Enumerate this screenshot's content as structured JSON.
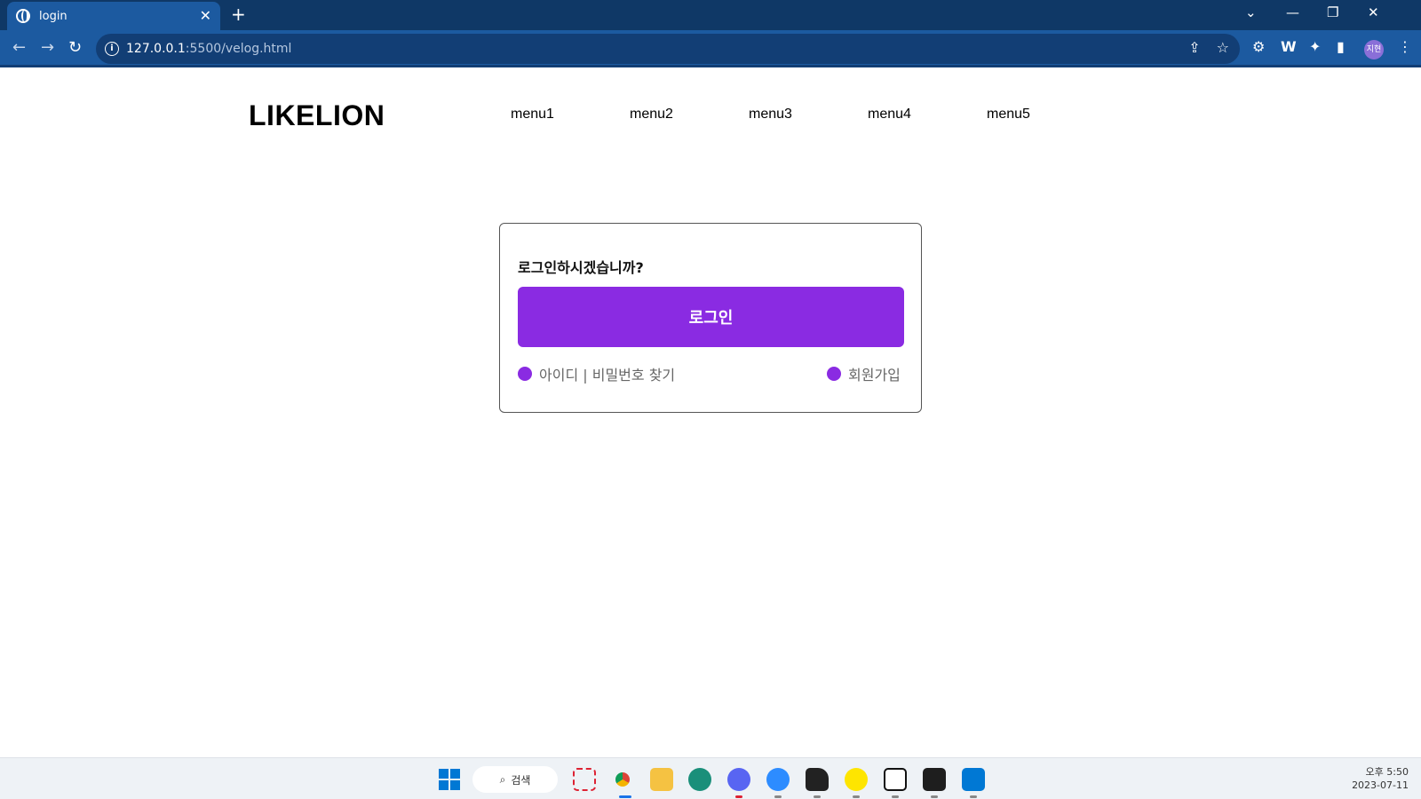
{
  "browser": {
    "tab_title": "login",
    "tab_close": "✕",
    "new_tab": "+",
    "url_host": "127.0.0.1",
    "url_path": ":5500/velog.html",
    "profile_label": "지현"
  },
  "header": {
    "logo": "LIKELION",
    "menu": [
      "menu1",
      "menu2",
      "menu3",
      "menu4",
      "menu5"
    ]
  },
  "login_card": {
    "question": "로그인하시겠습니까?",
    "login_button": "로그인",
    "find_account_link": "아이디 | 비밀번호 찾기",
    "signup_link": "회원가입"
  },
  "colors": {
    "accent": "#8a2be2",
    "browser_chrome": "#1c5aa0"
  },
  "taskbar": {
    "search_label": "검색",
    "time": "오후 5:50",
    "date": "2023-07-11"
  }
}
